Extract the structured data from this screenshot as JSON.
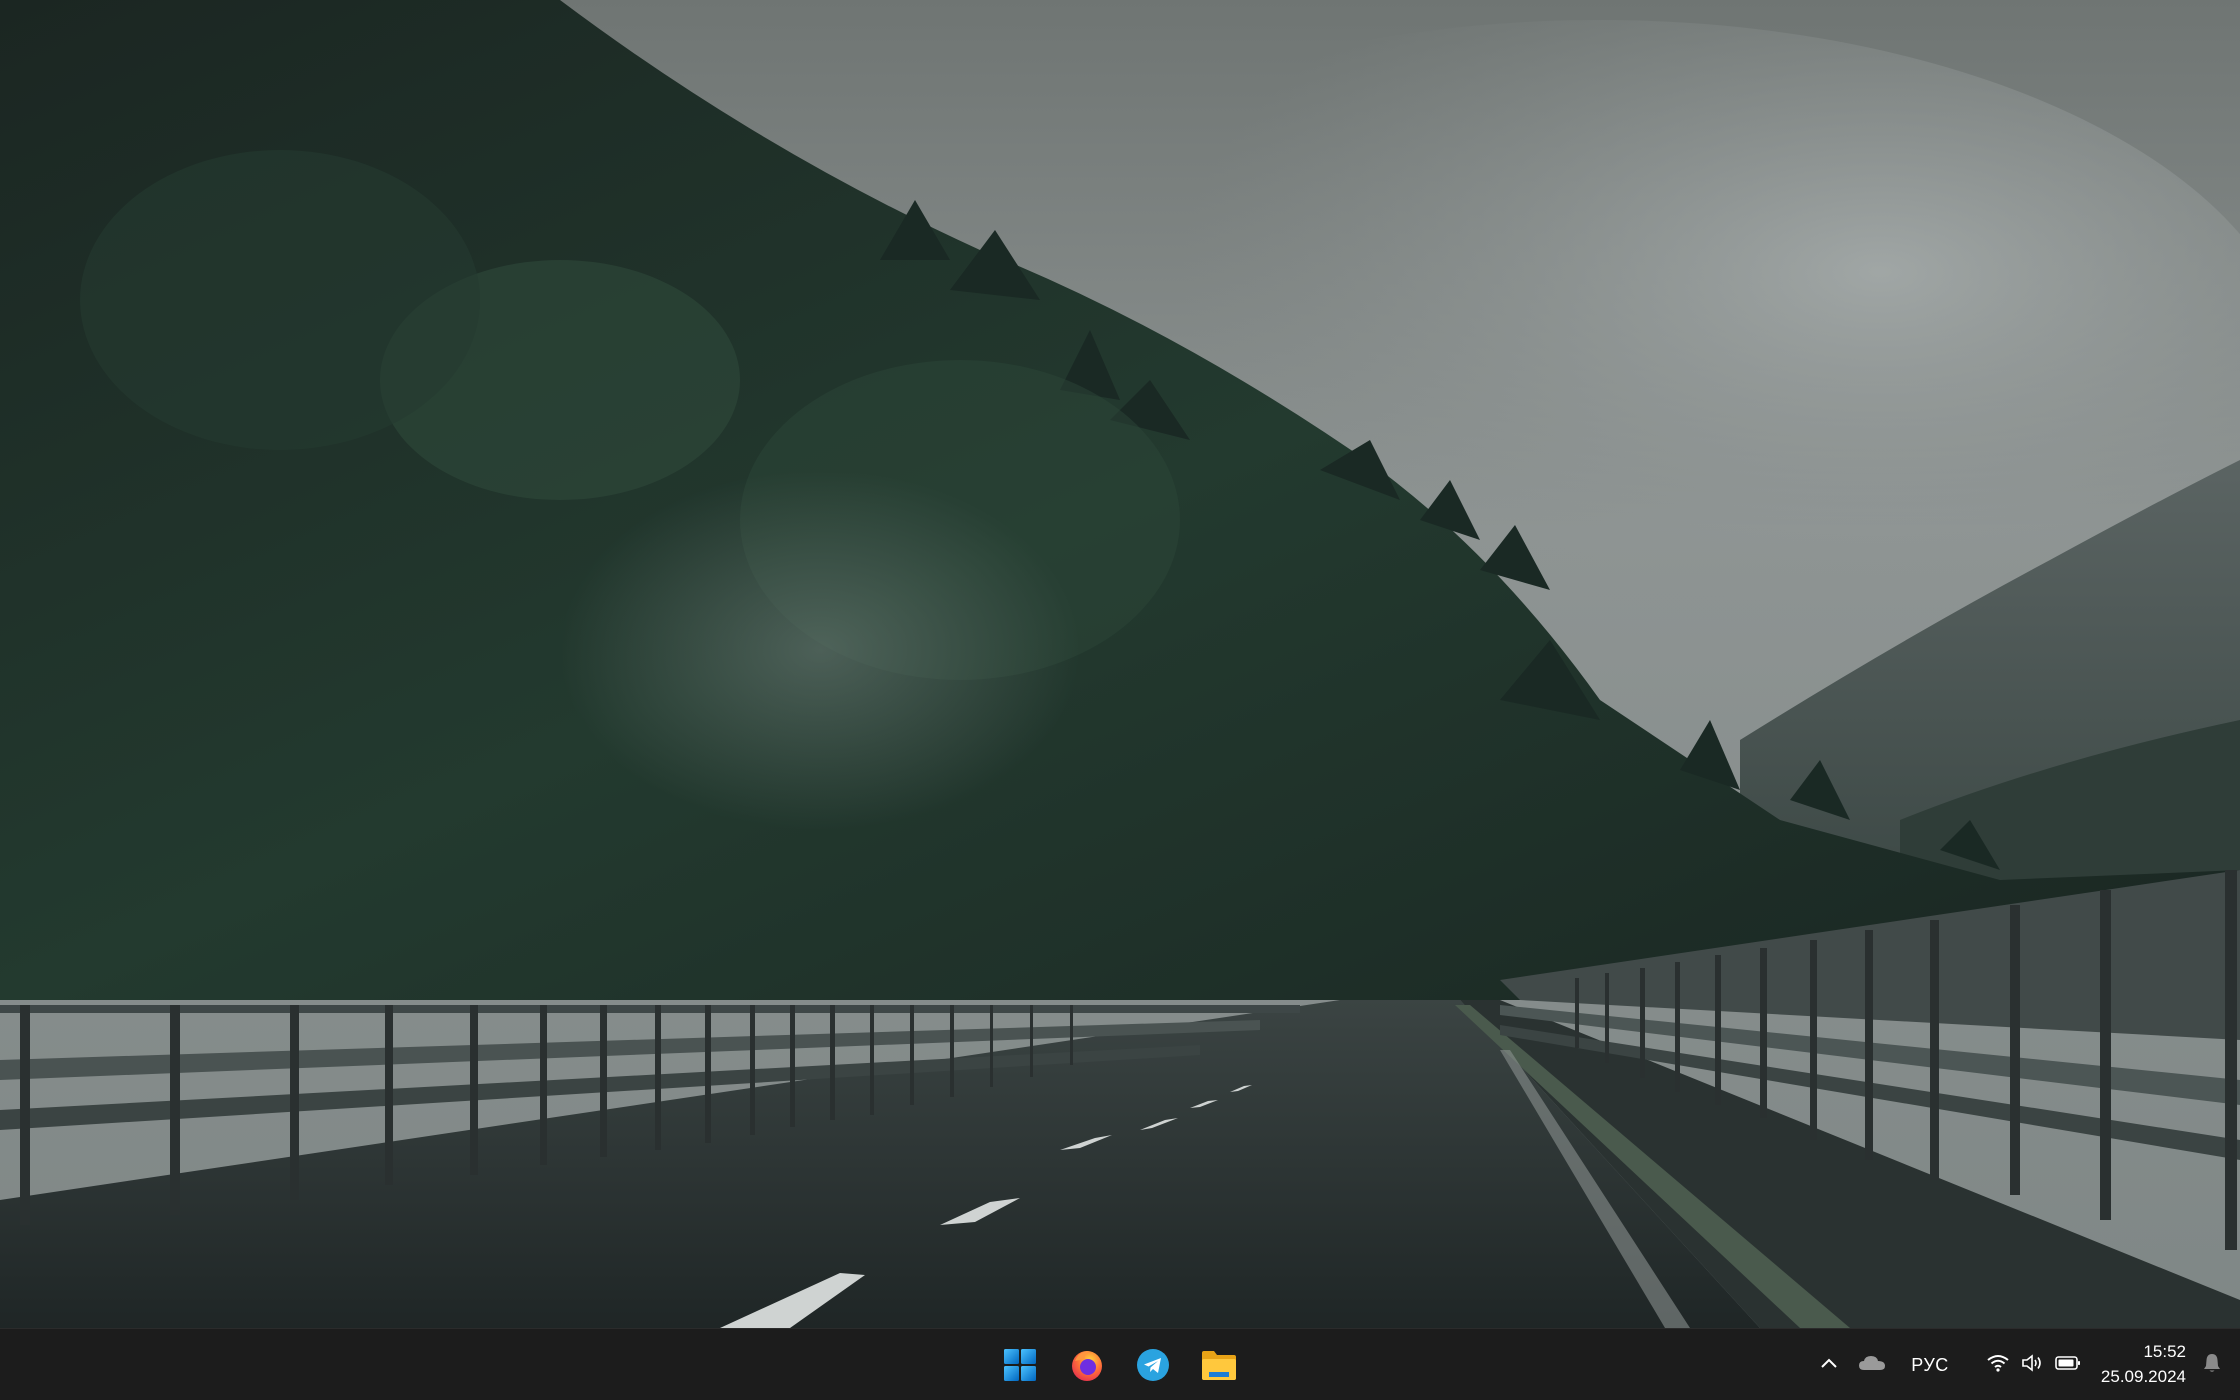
{
  "desktop": {
    "wallpaper": "foggy-mountain-road",
    "colors": {
      "sky": "#8c9392",
      "forest_dark": "#1d2a25",
      "forest_light": "#3b5a4a",
      "road": "#2b3332",
      "taskbar": "#1c1c1c"
    }
  },
  "taskbar": {
    "apps": [
      {
        "name": "Start",
        "icon": "windows-start-icon"
      },
      {
        "name": "Firefox",
        "icon": "firefox-icon"
      },
      {
        "name": "Telegram",
        "icon": "telegram-icon"
      },
      {
        "name": "File Explorer",
        "icon": "folder-icon"
      }
    ],
    "tray": {
      "overflow_icon": "chevron-up-icon",
      "onedrive_icon": "cloud-icon",
      "language": "РУС",
      "wifi_icon": "wifi-icon",
      "volume_icon": "volume-icon",
      "battery_icon": "battery-icon",
      "time": "15:52",
      "date": "25.09.2024",
      "notification_icon": "bell-icon"
    }
  }
}
